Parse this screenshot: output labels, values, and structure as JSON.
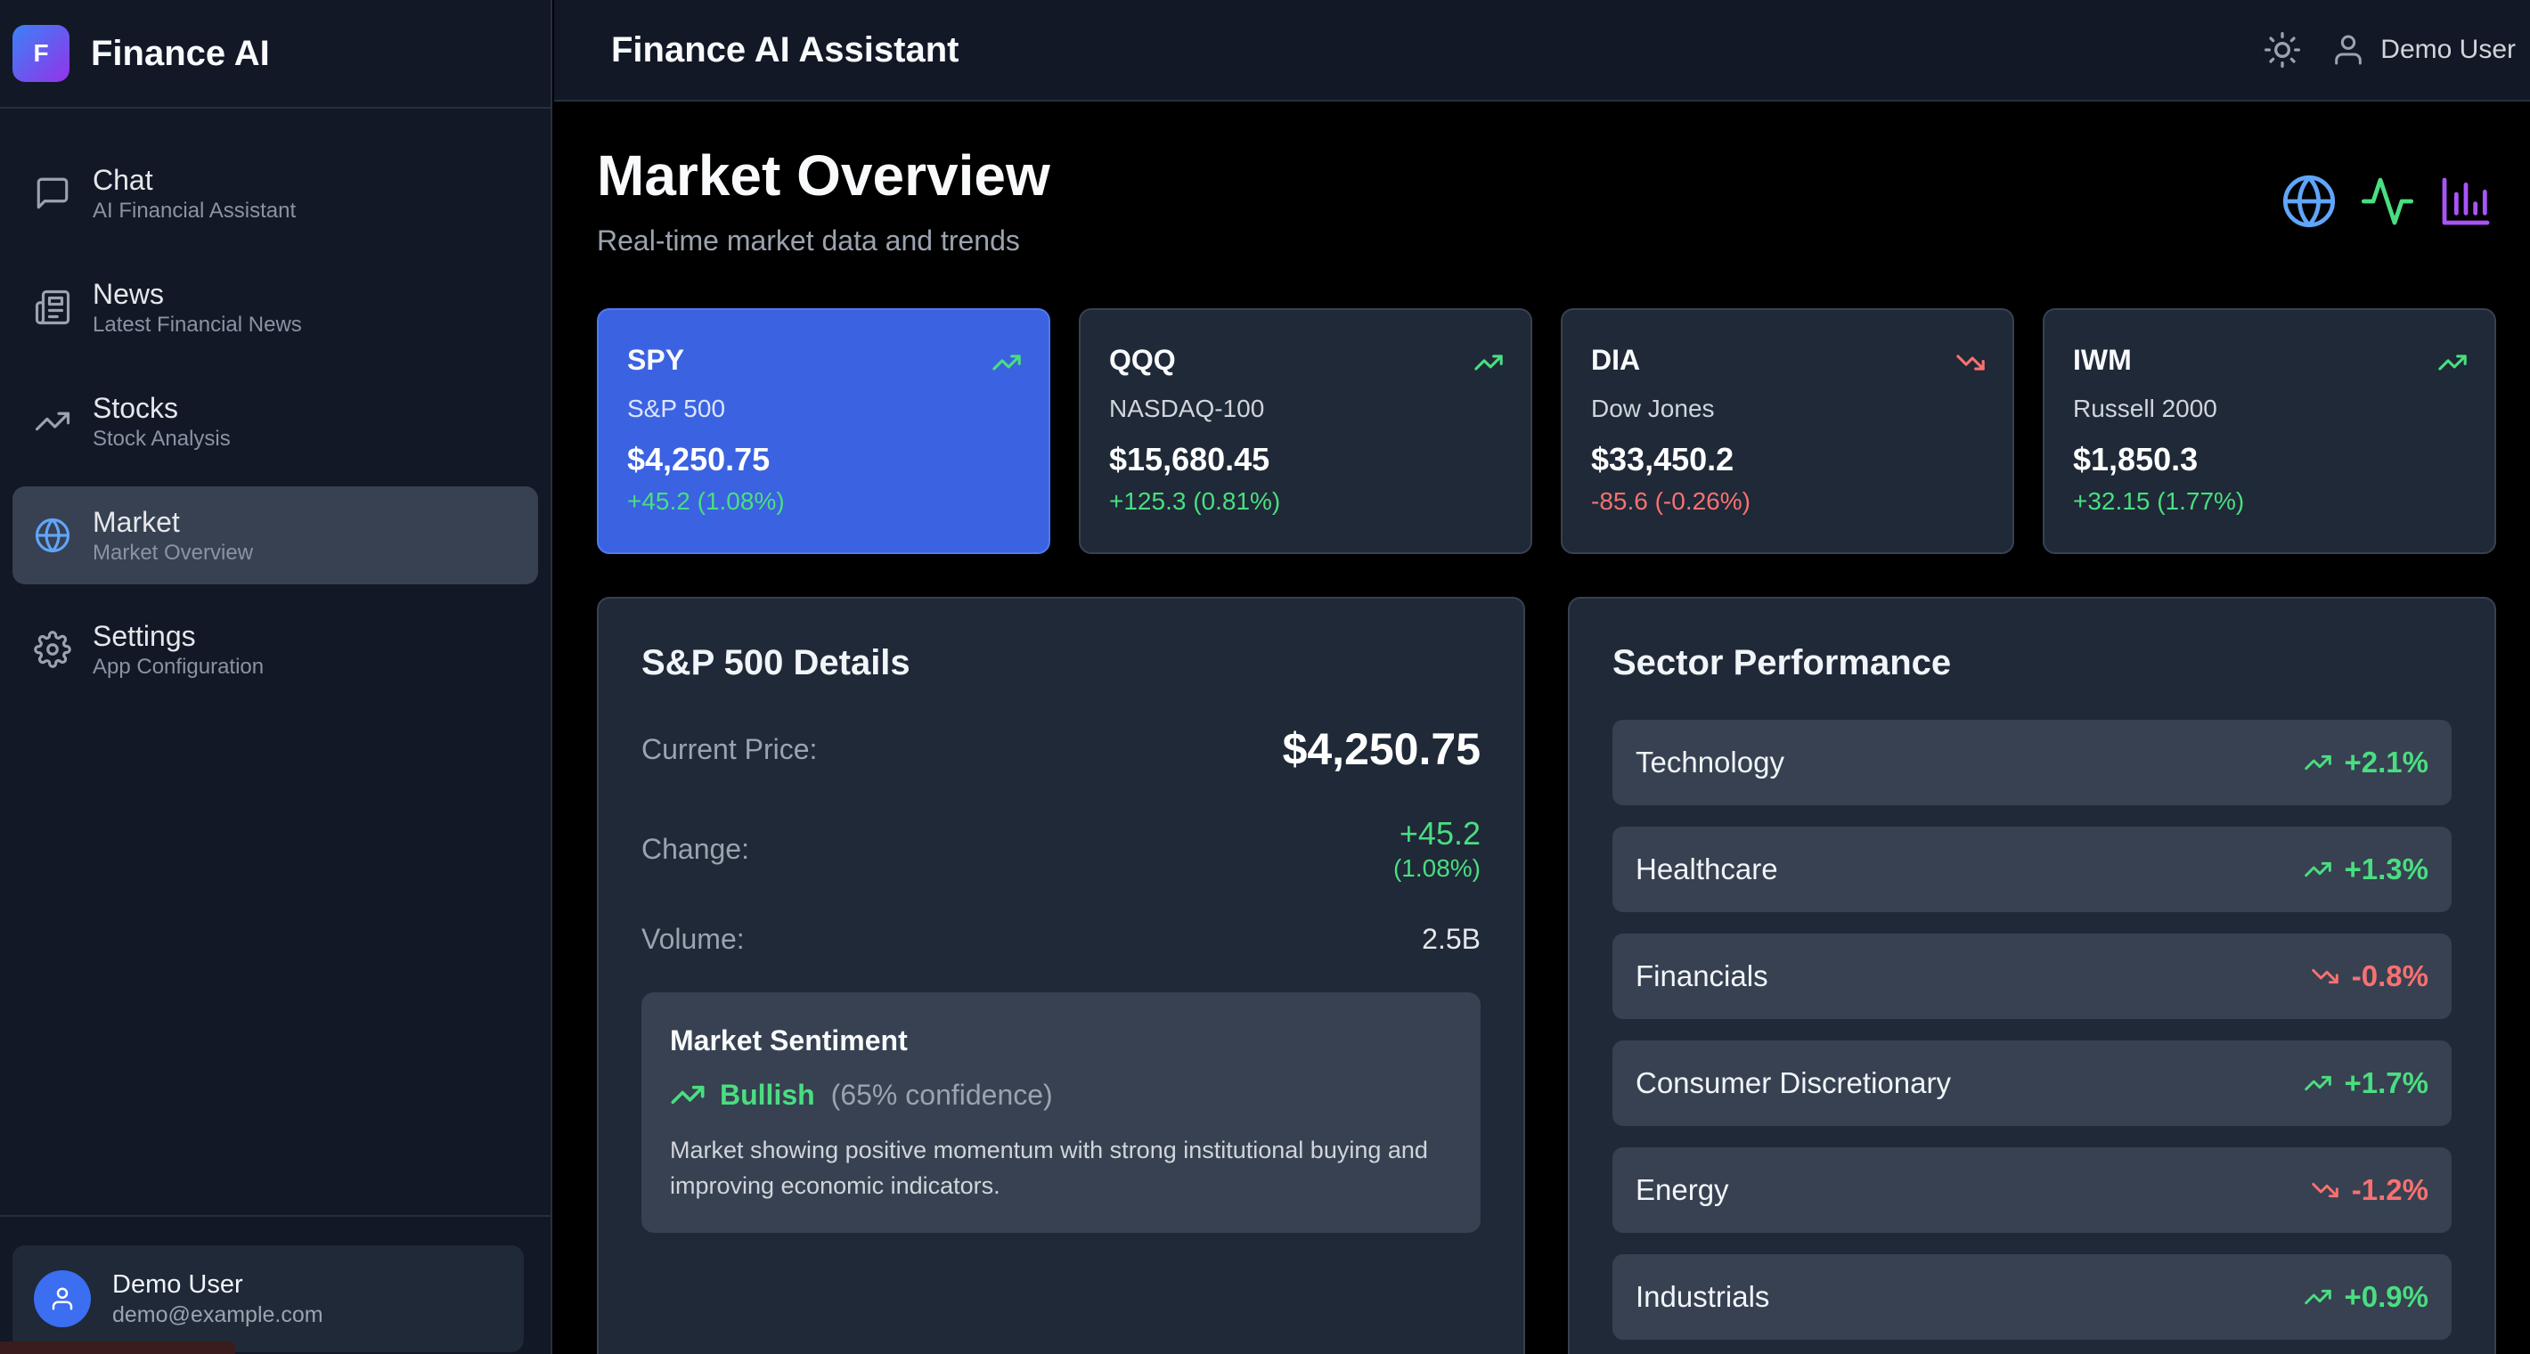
{
  "brand": {
    "logo_letter": "F",
    "name": "Finance AI"
  },
  "nav": [
    {
      "label": "Chat",
      "sub": "AI Financial Assistant",
      "icon": "chat-icon"
    },
    {
      "label": "News",
      "sub": "Latest Financial News",
      "icon": "newspaper-icon"
    },
    {
      "label": "Stocks",
      "sub": "Stock Analysis",
      "icon": "trending-up-icon"
    },
    {
      "label": "Market",
      "sub": "Market Overview",
      "icon": "globe-icon",
      "active": true
    },
    {
      "label": "Settings",
      "sub": "App Configuration",
      "icon": "gear-icon"
    }
  ],
  "sidebar_user": {
    "name": "Demo User",
    "email": "demo@example.com"
  },
  "topbar": {
    "title": "Finance AI Assistant",
    "user_name": "Demo User"
  },
  "page": {
    "title": "Market Overview",
    "subtitle": "Real-time market data and trends"
  },
  "indices": [
    {
      "symbol": "SPY",
      "name": "S&P 500",
      "price": "$4,250.75",
      "change": "+45.2 (1.08%)",
      "direction": "up",
      "active": true
    },
    {
      "symbol": "QQQ",
      "name": "NASDAQ-100",
      "price": "$15,680.45",
      "change": "+125.3 (0.81%)",
      "direction": "up"
    },
    {
      "symbol": "DIA",
      "name": "Dow Jones",
      "price": "$33,450.2",
      "change": "-85.6 (-0.26%)",
      "direction": "down"
    },
    {
      "symbol": "IWM",
      "name": "Russell 2000",
      "price": "$1,850.3",
      "change": "+32.15 (1.77%)",
      "direction": "up"
    }
  ],
  "details": {
    "title": "S&P 500 Details",
    "current_price_label": "Current Price:",
    "current_price": "$4,250.75",
    "change_label": "Change:",
    "change_value": "+45.2",
    "change_pct": "(1.08%)",
    "volume_label": "Volume:",
    "volume": "2.5B"
  },
  "sentiment": {
    "title": "Market Sentiment",
    "label": "Bullish",
    "confidence": "(65% confidence)",
    "description": "Market showing positive momentum with strong institutional buying and improving economic indicators."
  },
  "sectors": {
    "title": "Sector Performance",
    "items": [
      {
        "name": "Technology",
        "value": "+2.1%",
        "direction": "up"
      },
      {
        "name": "Healthcare",
        "value": "+1.3%",
        "direction": "up"
      },
      {
        "name": "Financials",
        "value": "-0.8%",
        "direction": "down"
      },
      {
        "name": "Consumer Discretionary",
        "value": "+1.7%",
        "direction": "up"
      },
      {
        "name": "Energy",
        "value": "-1.2%",
        "direction": "down"
      },
      {
        "name": "Industrials",
        "value": "+0.9%",
        "direction": "up"
      }
    ]
  },
  "colors": {
    "accent": "#3b62e0",
    "positive": "#4ade80",
    "negative": "#f87171",
    "header_globe": "#60a5fa",
    "header_activity": "#4ade80",
    "header_bars": "#a855f7"
  }
}
